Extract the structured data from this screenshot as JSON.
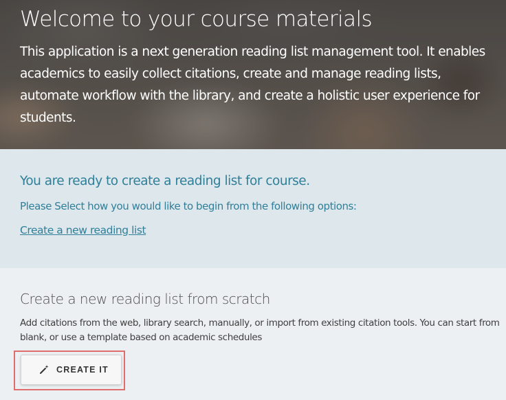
{
  "hero": {
    "title": "Welcome to your course materials",
    "description": "This application is a next generation reading list management tool. It enables academics to easily collect citations, create and manage reading lists, automate workflow with the library, and create a holistic user experience for students."
  },
  "ready": {
    "heading": "You are ready to create a reading list for course.",
    "subtitle": "Please Select how you would like to begin from the following options:",
    "link_label": "Create a new reading list"
  },
  "scratch": {
    "heading": "Create a new reading list from scratch",
    "description": "Add citations from the web, library search, manually, or import from existing citation tools. You can start from blank, or use a template based on academic schedules",
    "button": {
      "label": "CREATE IT",
      "icon": "magic-wand-icon"
    }
  },
  "colors": {
    "accent_teal": "#2f7f99",
    "ready_bg": "#dde7ec",
    "scratch_bg": "#edf0f2",
    "highlight_border": "#e06c6c"
  }
}
